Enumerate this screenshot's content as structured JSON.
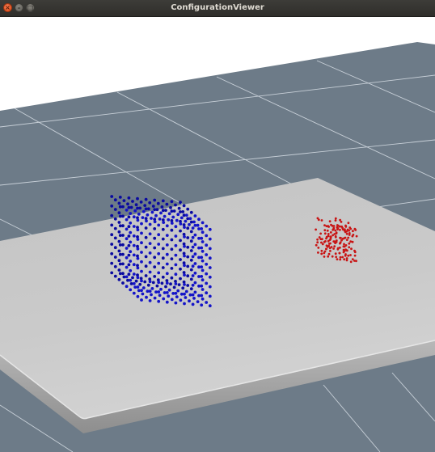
{
  "window": {
    "title": "ConfigurationViewer",
    "controls": {
      "close_glyph": "×",
      "minimize_glyph": "–",
      "maximize_glyph": "□"
    }
  },
  "scene": {
    "background_color": "#ffffff",
    "ground_color": "#6d7b88",
    "grid_line_color": "#c8d0d8",
    "table_top_color": "#c8c8c8",
    "table_edge_color": "#9b9b9b",
    "blue_cube_color": "#1414c8",
    "red_cluster_color": "#c81414"
  }
}
